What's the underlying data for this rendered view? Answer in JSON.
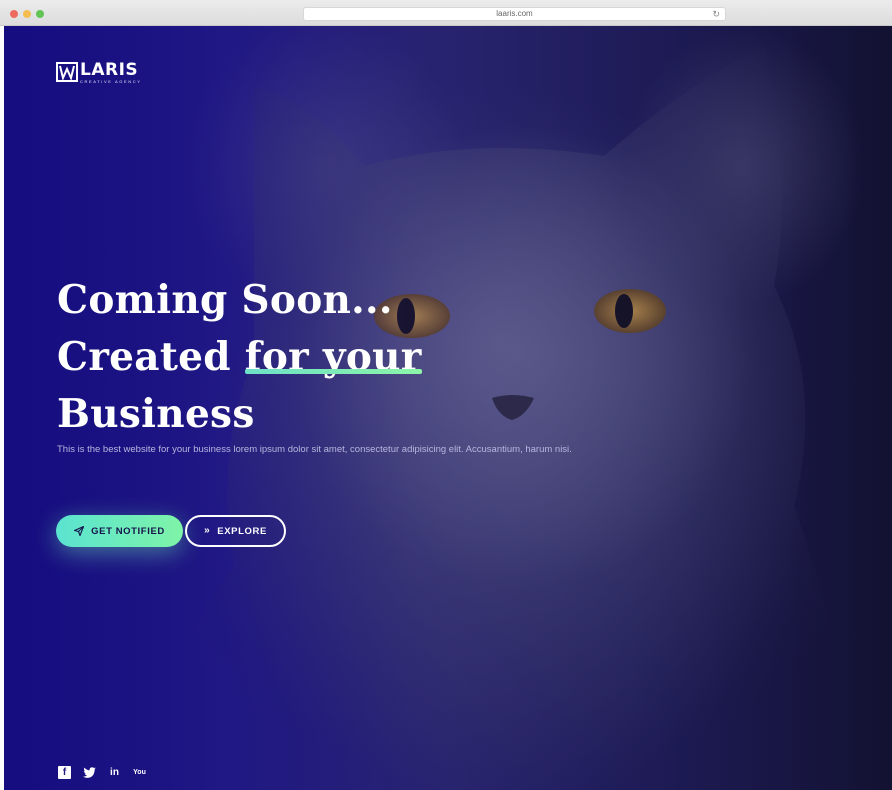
{
  "browser": {
    "url": "laaris.com",
    "reload_glyph": "↻"
  },
  "logo": {
    "name": "LARIS",
    "tagline": "CREATIVE AGENCY"
  },
  "hero": {
    "line1": "Coming Soon...",
    "line2_prefix": "Created ",
    "line2_highlight": "for your",
    "line3": "Business",
    "tagline": "This is the best website for your business lorem ipsum dolor sit amet, consectetur adipisicing elit. Accusantium, harum nisi."
  },
  "buttons": {
    "notify_label": "GET NOTIFIED",
    "notify_icon": "paper-plane-icon",
    "explore_label": "EXPLORE",
    "explore_icon": "double-chevron-right-icon"
  },
  "social": [
    {
      "name": "facebook-icon",
      "glyph": "f"
    },
    {
      "name": "twitter-icon",
      "glyph": "🐦"
    },
    {
      "name": "linkedin-icon",
      "glyph": "in"
    },
    {
      "name": "youtube-icon",
      "glyph": "You"
    }
  ],
  "colors": {
    "accent_start": "#5ae3d0",
    "accent_end": "#7ff4a8",
    "hero_overlay": "#17107e"
  }
}
